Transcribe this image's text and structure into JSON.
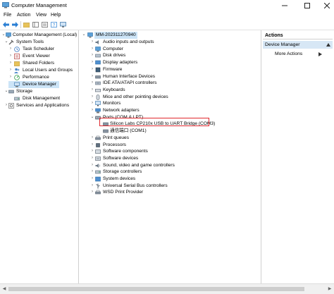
{
  "window": {
    "title": "Computer Management"
  },
  "menu": {
    "file": "File",
    "action": "Action",
    "view": "View",
    "help": "Help"
  },
  "left_tree": {
    "root": "Computer Management (Local)",
    "system_tools": "System Tools",
    "task_scheduler": "Task Scheduler",
    "event_viewer": "Event Viewer",
    "shared_folders": "Shared Folders",
    "local_users": "Local Users and Groups",
    "performance": "Performance",
    "device_manager": "Device Manager",
    "storage": "Storage",
    "disk_management": "Disk Management",
    "services_apps": "Services and Applications"
  },
  "device_tree": {
    "root": "MM-202311270940",
    "categories": [
      "Audio inputs and outputs",
      "Computer",
      "Disk drives",
      "Display adapters",
      "Firmware",
      "Human Interface Devices",
      "IDE ATA/ATAPI controllers",
      "Keyboards",
      "Mice and other pointing devices",
      "Monitors",
      "Network adapters",
      "Ports (COM & LPT)",
      "Print queues",
      "Processors",
      "Software components",
      "Software devices",
      "Sound, video and game controllers",
      "Storage controllers",
      "System devices",
      "Universal Serial Bus controllers",
      "WSD Print Provider"
    ],
    "ports_children": [
      "Silicon Labs CP210x USB to UART Bridge (COM3)",
      "通信端口 (COM1)"
    ]
  },
  "actions": {
    "header": "Actions",
    "section": "Device Manager",
    "more": "More Actions"
  },
  "colors": {
    "selection": "#cce4f7",
    "highlight": "#e0282e",
    "actions_section": "#d7e7f5"
  }
}
